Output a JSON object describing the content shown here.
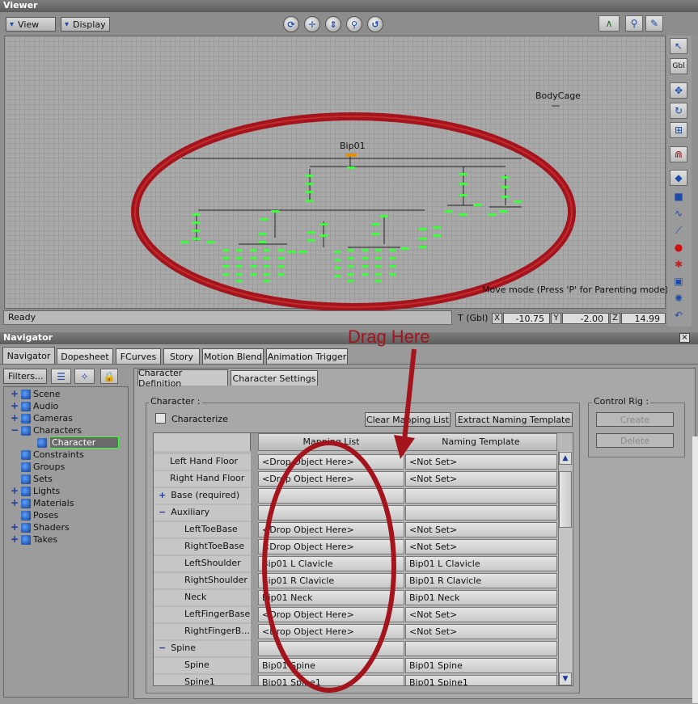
{
  "viewer": {
    "title": "Viewer",
    "view_menu": "View",
    "display_menu": "Display",
    "nav_icons": [
      "orbit-icon",
      "pan-icon",
      "dolly-icon",
      "zoom-icon",
      "reset-view-icon"
    ],
    "top_right_icons": [
      "curve-icon",
      "zoom-2d-icon",
      "camera-edit-icon"
    ],
    "labels": {
      "bodycage": "BodyCage",
      "bip01": "Bip01",
      "mode_hint": "Move mode (Press 'P' for Parenting mode)"
    },
    "status": "Ready",
    "transform_label": "T (Gbl)",
    "x_label": "X",
    "x_value": "-10.75",
    "y_label": "Y",
    "y_value": "-2.00",
    "z_label": "Z",
    "z_value": "14.99",
    "gbl_label": "Gbl",
    "side_tools": [
      "select-icon",
      "gbl-icon",
      "move-icon",
      "rotate-icon",
      "scale-icon",
      "magnet-icon",
      "select-object-icon",
      "cube-icon",
      "curve-tool-icon",
      "skeleton-tool-icon",
      "record-icon",
      "constraint-icon",
      "camera-icon",
      "light-icon",
      "undo-curve-icon"
    ]
  },
  "navigator": {
    "title": "Navigator",
    "close": "×",
    "tabs": [
      "Navigator",
      "Dopesheet",
      "FCurves",
      "Story",
      "Motion Blend",
      "Animation Trigger"
    ],
    "filters_label": "Filters...",
    "tree": [
      {
        "label": "Scene",
        "exp": "+",
        "level": 0
      },
      {
        "label": "Audio",
        "exp": "+",
        "level": 0
      },
      {
        "label": "Cameras",
        "exp": "+",
        "level": 0
      },
      {
        "label": "Characters",
        "exp": "−",
        "level": 0
      },
      {
        "label": "Character",
        "exp": "",
        "level": 1,
        "selected": true
      },
      {
        "label": "Constraints",
        "exp": "",
        "level": 0
      },
      {
        "label": "Groups",
        "exp": "",
        "level": 0
      },
      {
        "label": "Sets",
        "exp": "",
        "level": 0
      },
      {
        "label": "Lights",
        "exp": "+",
        "level": 0
      },
      {
        "label": "Materials",
        "exp": "+",
        "level": 0
      },
      {
        "label": "Poses",
        "exp": "",
        "level": 0
      },
      {
        "label": "Shaders",
        "exp": "+",
        "level": 0
      },
      {
        "label": "Takes",
        "exp": "+",
        "level": 0
      }
    ]
  },
  "character_panel": {
    "tabs": [
      "Character Definition",
      "Character Settings"
    ],
    "group_label": "Character :",
    "characterize_label": "Characterize",
    "clear_button": "Clear Mapping List",
    "extract_button": "Extract Naming Template",
    "col_mapping": "Mapping List",
    "col_naming": "Naming Template",
    "rows": [
      {
        "name": "Left Hand Floor",
        "level": 0,
        "exp": "",
        "map": "<Drop Object Here>",
        "naming": "<Not Set>"
      },
      {
        "name": "Right Hand Floor",
        "level": 0,
        "exp": "",
        "map": "<Drop Object Here>",
        "naming": "<Not Set>"
      },
      {
        "name": "Base (required)",
        "level": 0,
        "exp": "+",
        "map": "",
        "naming": ""
      },
      {
        "name": "Auxiliary",
        "level": 0,
        "exp": "−",
        "map": "",
        "naming": ""
      },
      {
        "name": "LeftToeBase",
        "level": 1,
        "exp": "",
        "map": "<Drop Object Here>",
        "naming": "<Not Set>"
      },
      {
        "name": "RightToeBase",
        "level": 1,
        "exp": "",
        "map": "<Drop Object Here>",
        "naming": "<Not Set>"
      },
      {
        "name": "LeftShoulder",
        "level": 1,
        "exp": "",
        "map": "Bip01 L Clavicle",
        "naming": "Bip01 L Clavicle"
      },
      {
        "name": "RightShoulder",
        "level": 1,
        "exp": "",
        "map": "Bip01 R Clavicle",
        "naming": "Bip01 R Clavicle"
      },
      {
        "name": "Neck",
        "level": 1,
        "exp": "",
        "map": "Bip01 Neck",
        "naming": "Bip01 Neck"
      },
      {
        "name": "LeftFingerBase",
        "level": 1,
        "exp": "",
        "map": "<Drop Object Here>",
        "naming": "<Not Set>"
      },
      {
        "name": "RightFingerB...",
        "level": 1,
        "exp": "",
        "map": "<Drop Object Here>",
        "naming": "<Not Set>"
      },
      {
        "name": "Spine",
        "level": 0,
        "exp": "−",
        "map": "",
        "naming": ""
      },
      {
        "name": "Spine",
        "level": 1,
        "exp": "",
        "map": "Bip01 Spine",
        "naming": "Bip01 Spine"
      },
      {
        "name": "Spine1",
        "level": 1,
        "exp": "",
        "map": "Bip01 Spine1",
        "naming": "Bip01 Spine1"
      }
    ]
  },
  "control_rig": {
    "label": "Control Rig :",
    "create": "Create",
    "delete": "Delete"
  },
  "annotation": {
    "text": "Drag Here",
    "color": "#a3141c"
  },
  "colors": {
    "accent_red": "#a3141c",
    "node_green": "#3cff3c"
  }
}
